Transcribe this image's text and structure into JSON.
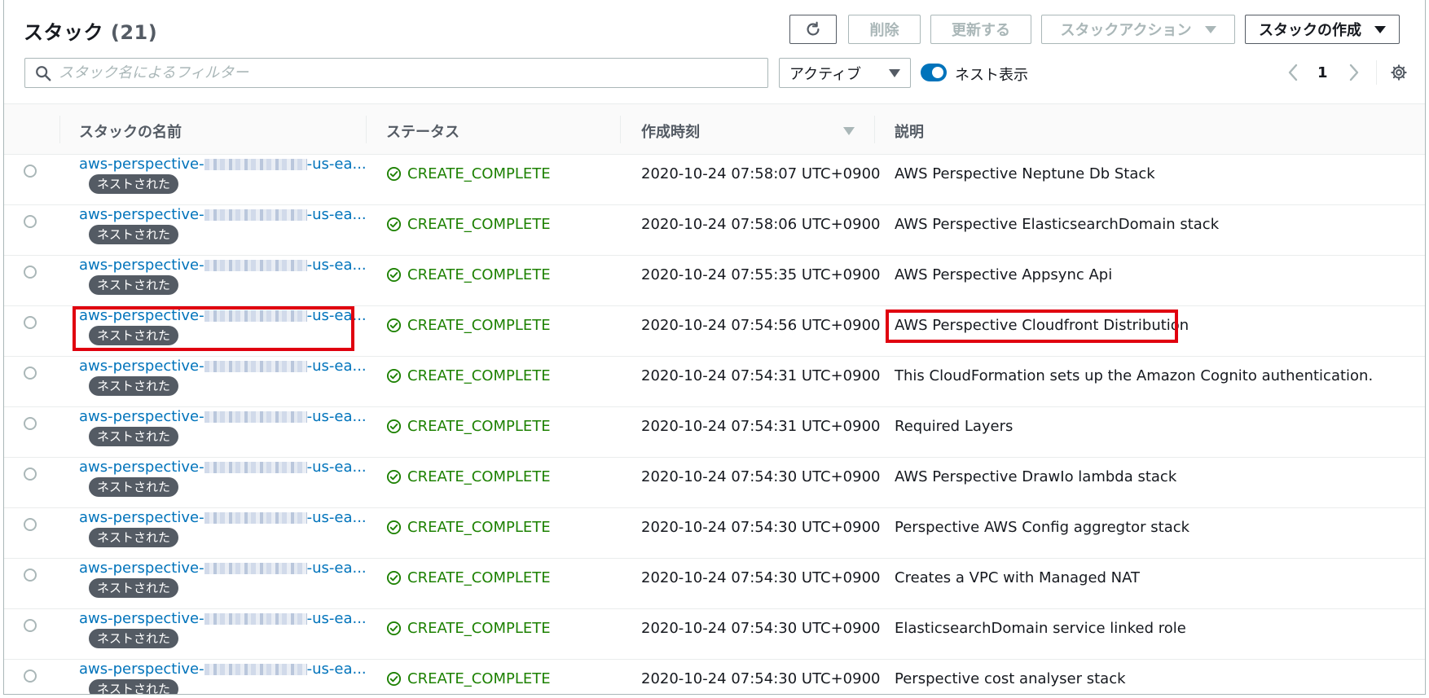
{
  "header": {
    "title": "スタック",
    "count": "(21)",
    "buttons": {
      "refresh_icon": "refresh-icon",
      "delete": "削除",
      "update": "更新する",
      "stack_actions": "スタックアクション",
      "create_stack": "スタックの作成"
    }
  },
  "toolbar": {
    "search_placeholder": "スタック名によるフィルター",
    "filter_value": "アクティブ",
    "toggle_label": "ネスト表示",
    "toggle_on": true,
    "page": "1"
  },
  "table": {
    "columns": {
      "name": "スタックの名前",
      "status": "ステータス",
      "created": "作成時刻",
      "description": "説明"
    },
    "nested_badge": "ネストされた",
    "rows": [
      {
        "name_prefix": "aws-perspective-",
        "name_suffix": "-us-ea...",
        "status": "CREATE_COMPLETE",
        "created": "2020-10-24 07:58:07 UTC+0900",
        "description": "AWS Perspective Neptune Db Stack"
      },
      {
        "name_prefix": "aws-perspective-",
        "name_suffix": "-us-ea...",
        "status": "CREATE_COMPLETE",
        "created": "2020-10-24 07:58:06 UTC+0900",
        "description": "AWS Perspective ElasticsearchDomain stack"
      },
      {
        "name_prefix": "aws-perspective-",
        "name_suffix": "-us-ea...",
        "status": "CREATE_COMPLETE",
        "created": "2020-10-24 07:55:35 UTC+0900",
        "description": "AWS Perspective Appsync Api"
      },
      {
        "name_prefix": "aws-perspective-",
        "name_suffix": "-us-ea...",
        "status": "CREATE_COMPLETE",
        "created": "2020-10-24 07:54:56 UTC+0900",
        "description": "AWS Perspective Cloudfront Distribution"
      },
      {
        "name_prefix": "aws-perspective-",
        "name_suffix": "-us-ea...",
        "status": "CREATE_COMPLETE",
        "created": "2020-10-24 07:54:31 UTC+0900",
        "description": "This CloudFormation sets up the Amazon Cognito authentication."
      },
      {
        "name_prefix": "aws-perspective-",
        "name_suffix": "-us-ea...",
        "status": "CREATE_COMPLETE",
        "created": "2020-10-24 07:54:31 UTC+0900",
        "description": "Required Layers"
      },
      {
        "name_prefix": "aws-perspective-",
        "name_suffix": "-us-ea...",
        "status": "CREATE_COMPLETE",
        "created": "2020-10-24 07:54:30 UTC+0900",
        "description": "AWS Perspective DrawIo lambda stack"
      },
      {
        "name_prefix": "aws-perspective-",
        "name_suffix": "-us-ea...",
        "status": "CREATE_COMPLETE",
        "created": "2020-10-24 07:54:30 UTC+0900",
        "description": "Perspective AWS Config aggregtor stack"
      },
      {
        "name_prefix": "aws-perspective-",
        "name_suffix": "-us-ea...",
        "status": "CREATE_COMPLETE",
        "created": "2020-10-24 07:54:30 UTC+0900",
        "description": "Creates a VPC with Managed NAT"
      },
      {
        "name_prefix": "aws-perspective-",
        "name_suffix": "-us-ea...",
        "status": "CREATE_COMPLETE",
        "created": "2020-10-24 07:54:30 UTC+0900",
        "description": "ElasticsearchDomain service linked role"
      },
      {
        "name_prefix": "aws-perspective-",
        "name_suffix": "-us-ea...",
        "status": "CREATE_COMPLETE",
        "created": "2020-10-24 07:54:30 UTC+0900",
        "description": "Perspective cost analyser stack"
      }
    ]
  },
  "colors": {
    "link": "#0073bb",
    "success": "#1d8102",
    "highlight": "#e0000f"
  }
}
